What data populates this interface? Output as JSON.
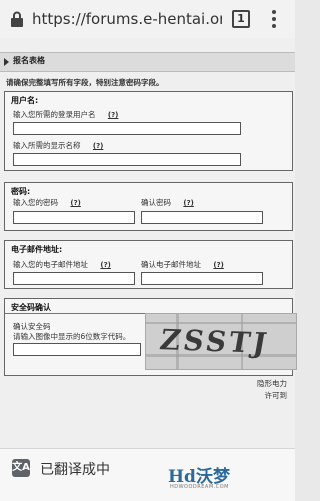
{
  "browser": {
    "url": "https://forums.e-hentai.org/ir",
    "tab_count": "1"
  },
  "page": {
    "heading": "报名表格",
    "notice": "请确保完整填写所有字段，特别注意密码字段。",
    "sections": {
      "username": {
        "title": "用户名:",
        "login_label": "输入您所需的登录用户名",
        "display_label": "输入所需的显示名称",
        "help": "(?)"
      },
      "password": {
        "title": "密码:",
        "enter_label": "输入您的密码",
        "confirm_label": "确认密码",
        "help": "(?)"
      },
      "email": {
        "title": "电子邮件地址:",
        "enter_label": "输入您的电子邮件地址",
        "confirm_label": "确认电子邮件地址",
        "help": "(?)"
      },
      "captcha": {
        "title": "安全码确认",
        "label_line1": "确认安全码",
        "label_line2": "请输入图像中显示的6位数字代码。",
        "image_text": "ZSSTJ"
      }
    },
    "trailing_text_1": "隐形电力",
    "trailing_text_2": "许可到"
  },
  "translate_bar": {
    "icon_text": "文A",
    "label": "已翻译成中"
  },
  "watermark": {
    "main": "Hd沃梦",
    "sub": "HDWOODREAM.COM"
  }
}
